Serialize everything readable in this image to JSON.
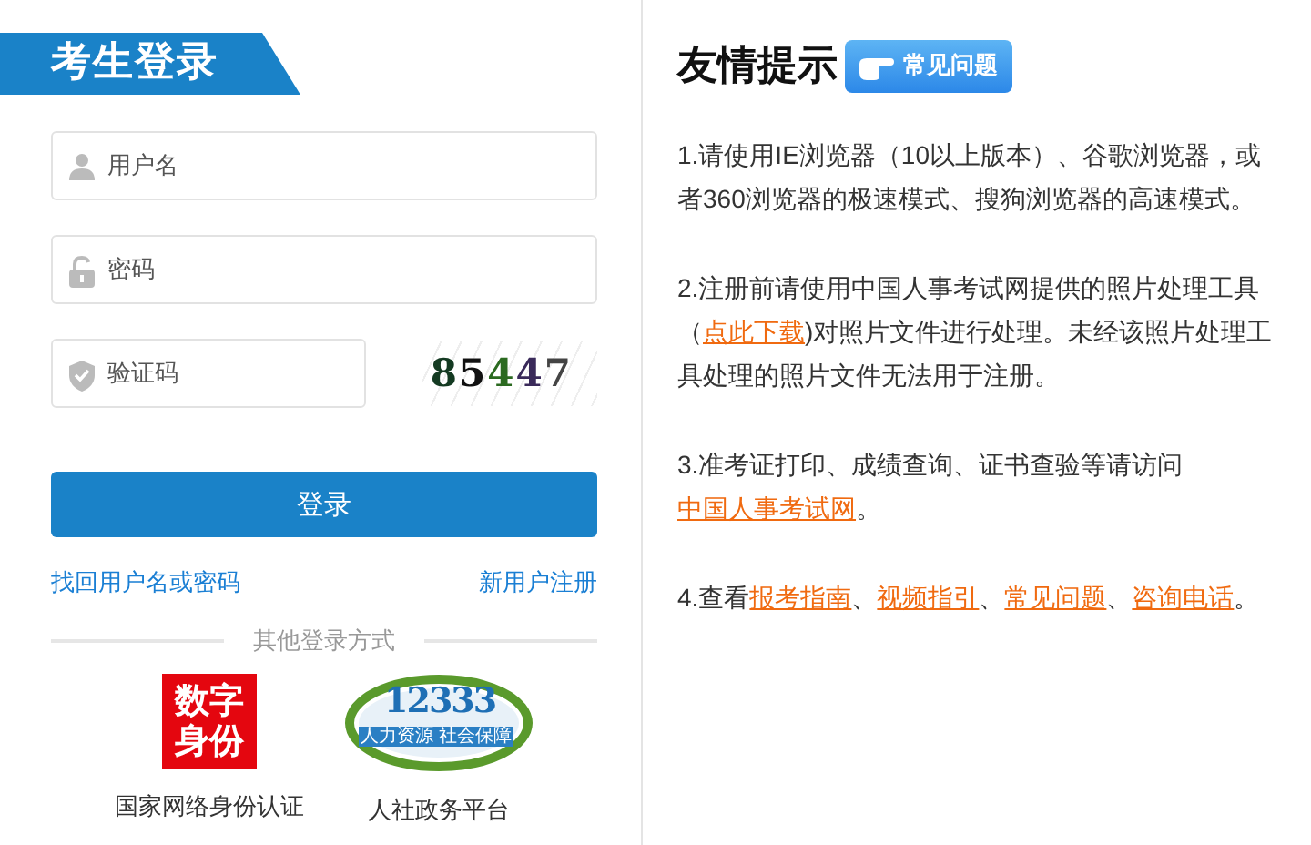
{
  "login": {
    "title": "考生登录",
    "fields": [
      {
        "kind": "user",
        "placeholder": "用户名"
      },
      {
        "kind": "lock",
        "placeholder": "密码"
      },
      {
        "kind": "shield",
        "placeholder": "验证码"
      }
    ],
    "captcha": {
      "text": "85447"
    },
    "submit": "登录",
    "links": [
      "找回用户名或密码",
      "新用户注册"
    ],
    "divider": "其他登录方式",
    "providers": [
      {
        "kind": "digital-id",
        "logo_text": "数字身份",
        "caption": "国家网络身份认证"
      },
      {
        "kind": "hotline",
        "logo_text": "12333",
        "logo_subtext": "人力资源 社会保障",
        "caption": "人社政务平台"
      }
    ]
  },
  "tips": {
    "title": "友情提示",
    "faq_button": "常见问题",
    "paragraphs": [
      [
        {
          "text": "1.请使用IE浏览器（10以上版本）、谷歌浏览器，或者360浏览器的极速模式、搜狗浏览器的高速模式。",
          "link": false
        }
      ],
      [
        {
          "text": "2.注册前请使用中国人事考试网提供的照片处理工具（",
          "link": false
        },
        {
          "text": "点此下载",
          "link": true
        },
        {
          "text": ")对照片文件进行处理。未经该照片处理工具处理的照片文件无法用于注册。",
          "link": false
        }
      ],
      [
        {
          "text": "3.准考证打印、成绩查询、证书查验等请访问",
          "link": false
        },
        {
          "text": "中国人事考试网",
          "link": true
        },
        {
          "text": "。",
          "link": false
        }
      ],
      [
        {
          "text": "4.查看",
          "link": false
        },
        {
          "text": "报考指南",
          "link": true
        },
        {
          "text": "、",
          "link": false
        },
        {
          "text": "视频指引",
          "link": true
        },
        {
          "text": "、",
          "link": false
        },
        {
          "text": "常见问题",
          "link": true
        },
        {
          "text": "、",
          "link": false
        },
        {
          "text": "咨询电话",
          "link": true
        },
        {
          "text": "。",
          "link": false
        }
      ]
    ]
  }
}
